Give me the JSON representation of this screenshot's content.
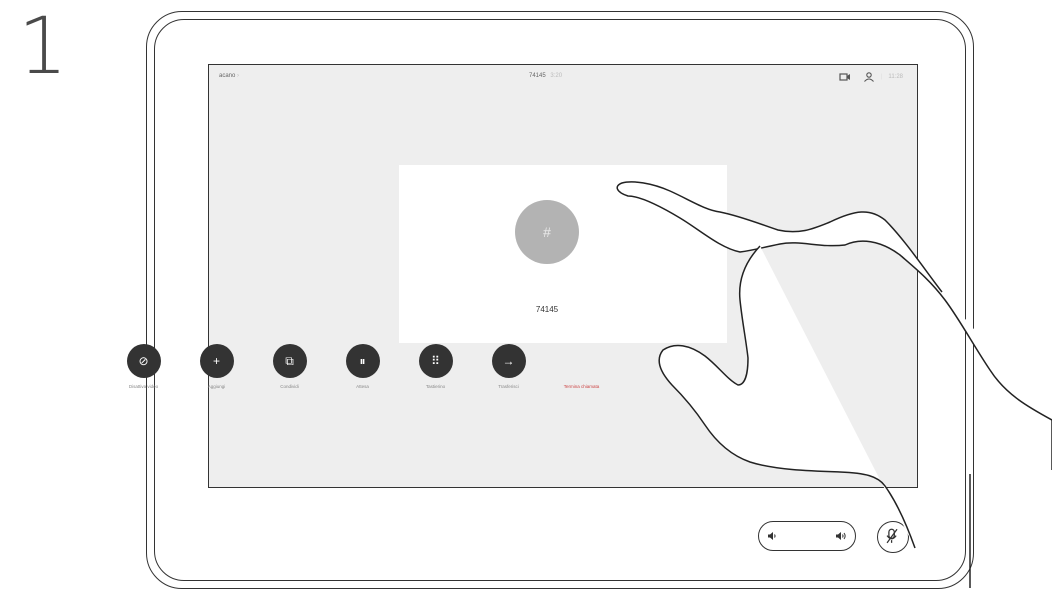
{
  "step": {
    "number": "1"
  },
  "topbar": {
    "left_label": "acano",
    "left_suffix": "›",
    "call_number": "74145",
    "call_time": "3:20",
    "clock": "11:28",
    "icons": [
      "self-view-icon",
      "participants-icon"
    ]
  },
  "call_card": {
    "avatar_glyph": "#",
    "name": "74145"
  },
  "controls": [
    {
      "icon": "video-off-icon",
      "glyph": "⊘",
      "label": "Disattiva video"
    },
    {
      "icon": "plus-icon",
      "glyph": "+",
      "label": "Aggiungi"
    },
    {
      "icon": "share-icon",
      "glyph": "⧉",
      "label": "Condividi"
    },
    {
      "icon": "pause-icon",
      "glyph": "⏸",
      "label": "Attesa"
    },
    {
      "icon": "keypad-icon",
      "glyph": "⠿",
      "label": "Tastierino"
    },
    {
      "icon": "transfer-icon",
      "glyph": "→",
      "label": "Trasferisci"
    },
    {
      "icon": "end-call-icon",
      "glyph": "",
      "label": "Termina chiamata"
    }
  ],
  "hardware": {
    "volume_control": "volume",
    "mute_button": "mute"
  }
}
